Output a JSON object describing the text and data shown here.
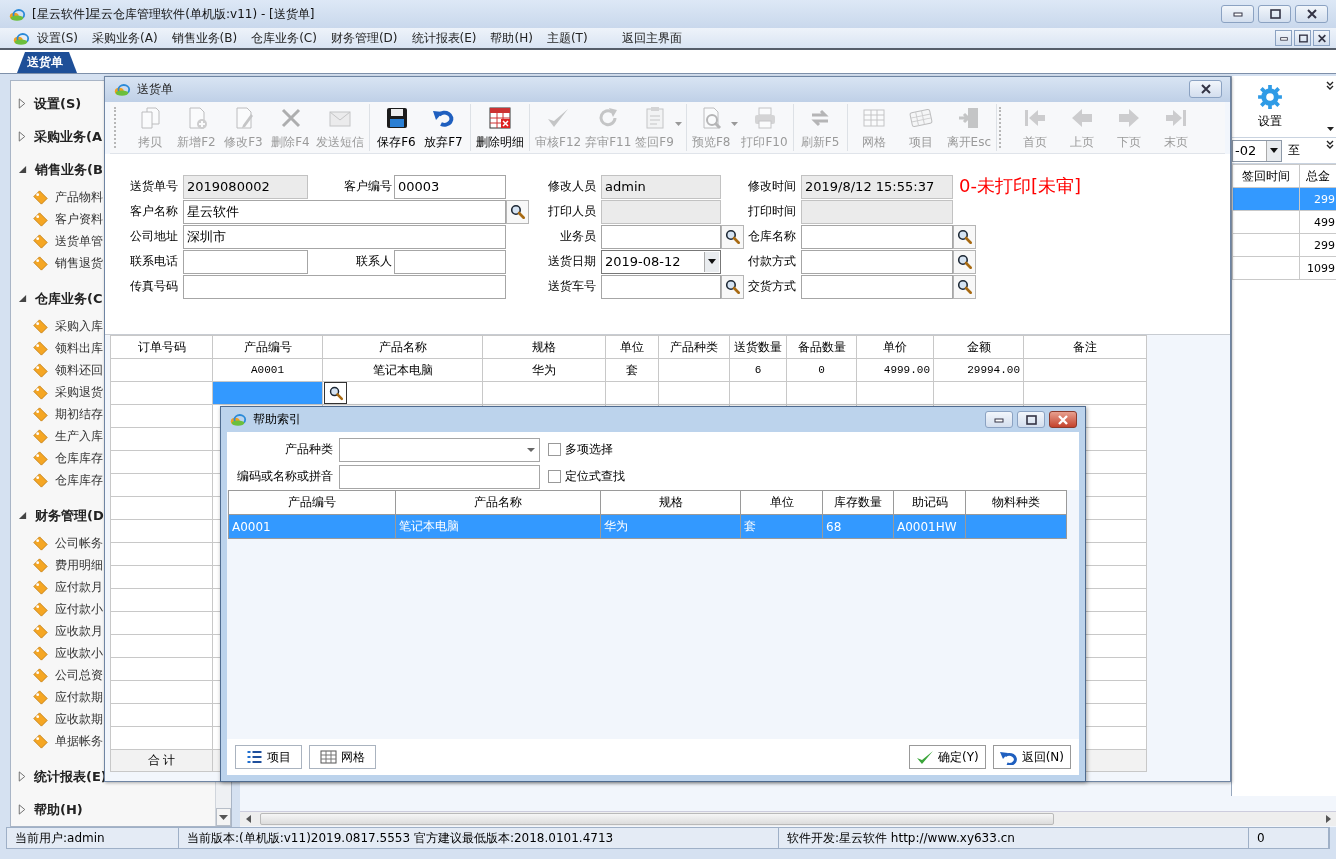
{
  "window": {
    "title": "[星云软件]星云仓库管理软件(单机版:v11) - [送货单]"
  },
  "menu": [
    "设置(S)",
    "采购业务(A)",
    "销售业务(B)",
    "仓库业务(C)",
    "财务管理(D)",
    "统计报表(E)",
    "帮助(H)",
    "主题(T)",
    "返回主界面"
  ],
  "tabs": [
    {
      "label": "送货单",
      "selected": true
    }
  ],
  "sidebar": {
    "sections": [
      {
        "label": "设置(S)",
        "expanded": false
      },
      {
        "label": "采购业务(A",
        "expanded": false
      },
      {
        "label": "销售业务(B",
        "expanded": true,
        "children": [
          "产品物料",
          "客户资料",
          "送货单管",
          "销售退货"
        ]
      },
      {
        "label": "仓库业务(C",
        "expanded": true,
        "children": [
          "采购入库",
          "领料出库",
          "领料还回",
          "采购退货",
          "期初结存",
          "生产入库",
          "仓库库存",
          "仓库库存"
        ]
      },
      {
        "label": "财务管理(D",
        "expanded": true,
        "children": [
          "公司帐务",
          "费用明细",
          "应付款月",
          "应付款小",
          "应收款月",
          "应收款小",
          "公司总资",
          "应付款期",
          "应收款期",
          "单据帐务"
        ]
      },
      {
        "label": "统计报表(E)",
        "expanded": false
      },
      {
        "label": "帮助(H)",
        "expanded": false
      }
    ]
  },
  "side_panel": {
    "settings_label": "设置",
    "date_value": "-02",
    "to_label": "至",
    "grid": {
      "columns": [
        "签回时间",
        "总金"
      ],
      "rows": [
        {
          "cells": [
            null,
            "299"
          ],
          "selected": true
        },
        {
          "cells": [
            null,
            "499"
          ],
          "selected": false
        },
        {
          "cells": [
            null,
            "299"
          ],
          "selected": false
        },
        {
          "cells": [
            null,
            "1099"
          ],
          "selected": false
        }
      ]
    }
  },
  "document_window": {
    "title": "送货单",
    "toolbar": [
      [
        {
          "label": "拷贝",
          "disabled": true,
          "dropdown": false
        },
        {
          "label": "新增F2",
          "disabled": true,
          "dropdown": false
        },
        {
          "label": "修改F3",
          "disabled": true,
          "dropdown": false
        },
        {
          "label": "删除F4",
          "disabled": true,
          "dropdown": false
        },
        {
          "label": "发送短信",
          "disabled": true,
          "dropdown": false
        }
      ],
      [
        {
          "label": "保存F6",
          "disabled": false,
          "dropdown": false
        },
        {
          "label": "放弃F7",
          "disabled": false,
          "dropdown": false
        }
      ],
      [
        {
          "label": "删除明细",
          "disabled": false,
          "dropdown": false
        }
      ],
      [
        {
          "label": "审核F12",
          "disabled": true,
          "dropdown": false
        },
        {
          "label": "弃审F11",
          "disabled": true,
          "dropdown": false
        },
        {
          "label": "签回F9",
          "disabled": true,
          "dropdown": true
        }
      ],
      [
        {
          "label": "预览F8",
          "disabled": true,
          "dropdown": true
        },
        {
          "label": "打印F10",
          "disabled": true,
          "dropdown": false
        }
      ],
      [
        {
          "label": "刷新F5",
          "disabled": true,
          "dropdown": false
        }
      ],
      [
        {
          "label": "网格",
          "disabled": true,
          "dropdown": false
        },
        {
          "label": "项目",
          "disabled": true,
          "dropdown": false
        },
        {
          "label": "离开Esc",
          "disabled": true,
          "dropdown": false
        }
      ],
      [
        {
          "label": "首页",
          "disabled": true,
          "dropdown": false
        },
        {
          "label": "上页",
          "disabled": true,
          "dropdown": false
        },
        {
          "label": "下页",
          "disabled": true,
          "dropdown": false
        },
        {
          "label": "末页",
          "disabled": true,
          "dropdown": false
        }
      ]
    ],
    "form": {
      "left": [
        [
          {
            "label": "送货单号",
            "value": "2019080002",
            "readonly": true,
            "lookup": false
          },
          {
            "label": "客户编号",
            "value": "00003",
            "readonly": false,
            "lookup": false
          }
        ],
        [
          {
            "label": "客户名称",
            "value": "星云软件",
            "readonly": false,
            "lookup": true
          }
        ],
        [
          {
            "label": "公司地址",
            "value": "深圳市",
            "readonly": false,
            "lookup": false
          }
        ],
        [
          {
            "label": "联系电话",
            "readonly": false,
            "lookup": false
          },
          {
            "label": "联系人",
            "readonly": false,
            "lookup": false
          }
        ],
        [
          {
            "label": "传真号码",
            "readonly": false,
            "lookup": false
          }
        ]
      ],
      "middle": [
        {
          "label": "修改人员",
          "value": "admin",
          "kind": "text",
          "readonly": true,
          "lookup": false
        },
        {
          "label": "打印人员",
          "kind": "text",
          "readonly": true,
          "lookup": false
        },
        {
          "label": "业务员",
          "kind": "text",
          "readonly": false,
          "lookup": true
        },
        {
          "label": "送货日期",
          "value": "2019-08-12",
          "kind": "date",
          "readonly": false,
          "lookup": false
        },
        {
          "label": "送货车号",
          "kind": "text",
          "readonly": false,
          "lookup": true
        }
      ],
      "right": [
        {
          "label": "修改时间",
          "value": "2019/8/12 15:55:37",
          "kind": "text",
          "readonly": true,
          "lookup": false
        },
        {
          "label": "打印时间",
          "kind": "text",
          "readonly": true,
          "lookup": false
        },
        {
          "label": "仓库名称",
          "kind": "text",
          "readonly": false,
          "lookup": true
        },
        {
          "label": "付款方式",
          "kind": "text",
          "readonly": false,
          "lookup": true
        },
        {
          "label": "交货方式",
          "kind": "text",
          "readonly": false,
          "lookup": true
        }
      ],
      "status": "0-未打印[未审]"
    },
    "detail_grid": {
      "columns": [
        "订单号码",
        "产品编号",
        "产品名称",
        "规格",
        "单位",
        "产品种类",
        "送货数量",
        "备品数量",
        "单价",
        "金额",
        "备注"
      ],
      "rows": [
        {
          "cells": [
            null,
            "A0001",
            "笔记本电脑",
            "华为",
            "套",
            null,
            "6",
            "0",
            "4999.00",
            "29994.00",
            null
          ],
          "selected": false
        }
      ],
      "entry_row": {
        "cells": [
          {
            "selected": false
          },
          {
            "selected": true
          },
          {
            "selected": false
          },
          {
            "selected": false
          },
          {
            "selected": false
          },
          {
            "selected": false
          },
          {
            "selected": false
          },
          {
            "selected": false
          },
          {
            "selected": false
          },
          {
            "selected": false
          },
          {
            "selected": false
          }
        ]
      },
      "footer": "合 计"
    }
  },
  "help_dialog": {
    "title": "帮助索引",
    "filters": [
      {
        "label": "产品种类",
        "kind": "dropdown"
      },
      {
        "label": "编码或名称或拼音",
        "kind": "text"
      }
    ],
    "options": [
      {
        "label": "多项选择",
        "checked": false
      },
      {
        "label": "定位式查找",
        "checked": false
      }
    ],
    "grid": {
      "columns": [
        "产品编号",
        "产品名称",
        "规格",
        "单位",
        "库存数量",
        "助记码",
        "物料种类"
      ],
      "rows": [
        {
          "cells": [
            "A0001",
            "笔记本电脑",
            "华为",
            "套",
            "68",
            "A0001HW",
            null
          ],
          "selected": true
        }
      ]
    },
    "buttons_left": [
      "项目",
      "网格"
    ],
    "buttons_right": [
      "确定(Y)",
      "返回(N)"
    ]
  },
  "status_bar": [
    "当前用户:admin",
    "当前版本:(单机版:v11)2019.0817.5553 官方建议最低版本:2018.0101.4713",
    "软件开发:星云软件 http://www.xy633.cn",
    "0"
  ]
}
